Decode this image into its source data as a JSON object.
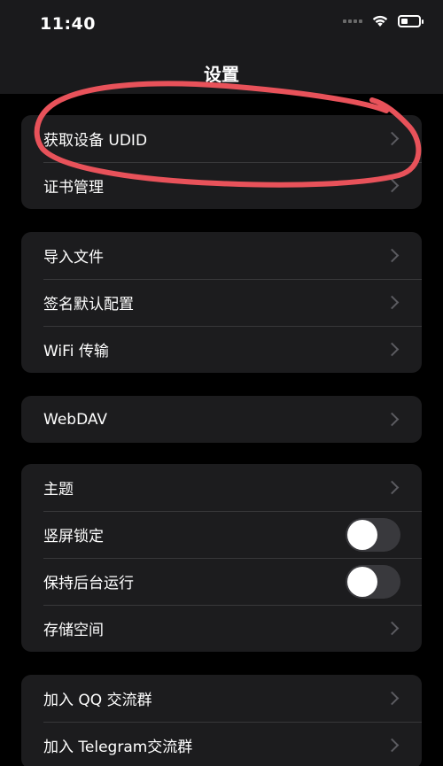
{
  "status_bar": {
    "time": "11:40",
    "icons": [
      "cellular-signal-icon",
      "wifi-icon",
      "battery-icon"
    ]
  },
  "header": {
    "title": "设置"
  },
  "groups": [
    {
      "rows": [
        {
          "label": "获取设备 UDID",
          "accessory": "chevron"
        },
        {
          "label": "证书管理",
          "accessory": "chevron"
        }
      ]
    },
    {
      "rows": [
        {
          "label": "导入文件",
          "accessory": "chevron"
        },
        {
          "label": "签名默认配置",
          "accessory": "chevron"
        },
        {
          "label": "WiFi 传输",
          "accessory": "chevron"
        }
      ]
    },
    {
      "rows": [
        {
          "label": "WebDAV",
          "accessory": "chevron"
        }
      ]
    },
    {
      "rows": [
        {
          "label": "主题",
          "accessory": "chevron"
        },
        {
          "label": "竖屏锁定",
          "accessory": "toggle",
          "on": false
        },
        {
          "label": "保持后台运行",
          "accessory": "toggle",
          "on": false
        },
        {
          "label": "存储空间",
          "accessory": "chevron"
        }
      ]
    },
    {
      "rows": [
        {
          "label": "加入 QQ 交流群",
          "accessory": "chevron"
        },
        {
          "label": "加入 Telegram交流群",
          "accessory": "chevron"
        }
      ]
    }
  ],
  "colors": {
    "background": "#000000",
    "header_bg": "#1a1a1c",
    "group_bg": "#1c1c1e",
    "separator": "#38383a",
    "chevron": "#5b5b60",
    "toggle_off": "#39393d",
    "annotation": "#e8525a"
  }
}
